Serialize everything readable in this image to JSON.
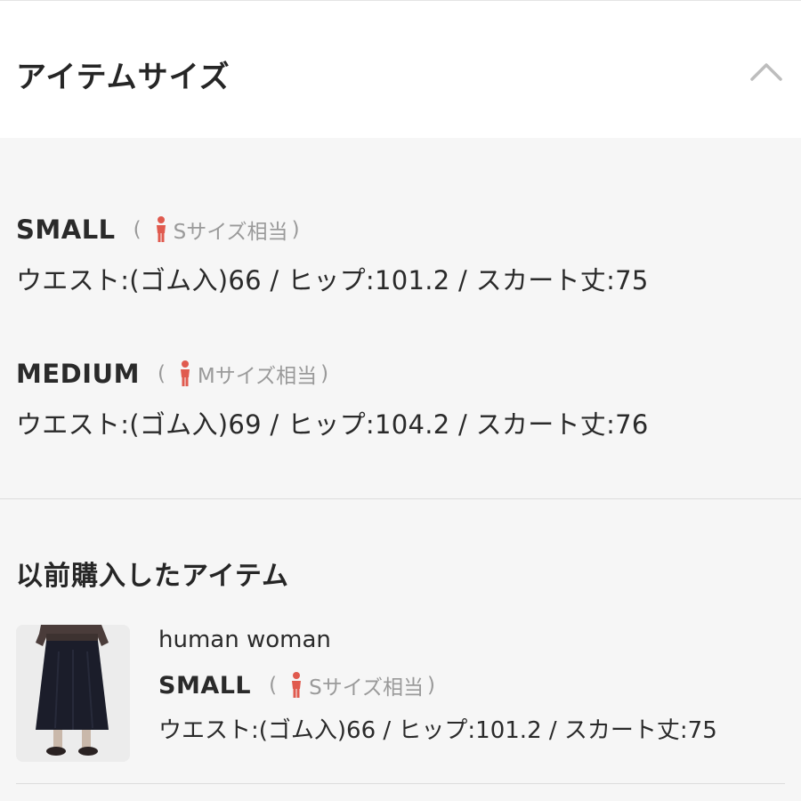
{
  "header": {
    "title": "アイテムサイズ"
  },
  "sizes": [
    {
      "name": "SMALL",
      "open": "(",
      "equiv": "Sサイズ相当",
      "close": ")",
      "measure": "ウエスト:(ゴム入)66 / ヒップ:101.2 / スカート丈:75"
    },
    {
      "name": "MEDIUM",
      "open": "(",
      "equiv": "Mサイズ相当",
      "close": ")",
      "measure": "ウエスト:(ゴム入)69 / ヒップ:104.2 / スカート丈:76"
    }
  ],
  "previous": {
    "title": "以前購入したアイテム",
    "item": {
      "brand": "human woman",
      "size_name": "SMALL",
      "open": "(",
      "equiv": "Sサイズ相当",
      "close": ")",
      "measure": "ウエスト:(ゴム入)66 / ヒップ:101.2 / スカート丈:75"
    }
  },
  "colors": {
    "accent_person": "#e05a4e",
    "muted_text": "#9a9a9a",
    "section_bg": "#f6f6f6"
  },
  "icons": {
    "collapse": "chevron-up-icon",
    "size_equivalent": "person-icon"
  }
}
